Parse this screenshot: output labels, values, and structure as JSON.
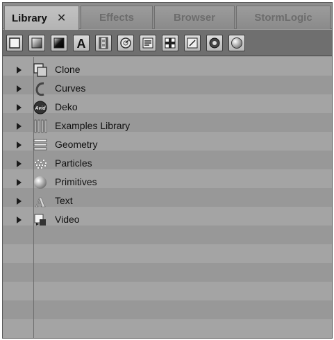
{
  "tabs": [
    {
      "label": "Library",
      "active": true
    },
    {
      "label": "Effects",
      "active": false
    },
    {
      "label": "Browser",
      "active": false
    },
    {
      "label": "StormLogic",
      "active": false
    }
  ],
  "tab_close_symbol": "✕",
  "toolbar_icons": [
    "square-outline-icon",
    "gradient-square-icon",
    "dark-gradient-square-icon",
    "letter-a-icon",
    "film-strip-icon",
    "dial-icon",
    "text-block-icon",
    "plus-grid-icon",
    "diagonal-line-box-icon",
    "donut-icon",
    "sphere-icon"
  ],
  "toolbar_letter": "A",
  "library_items": [
    {
      "label": "Clone",
      "icon": "clone-icon"
    },
    {
      "label": "Curves",
      "icon": "curves-icon"
    },
    {
      "label": "Deko",
      "icon": "deko-icon",
      "icon_text": "Avid"
    },
    {
      "label": "Examples Library",
      "icon": "examples-library-icon"
    },
    {
      "label": "Geometry",
      "icon": "geometry-icon"
    },
    {
      "label": "Particles",
      "icon": "particles-icon"
    },
    {
      "label": "Primitives",
      "icon": "primitives-icon"
    },
    {
      "label": "Text",
      "icon": "text-icon",
      "icon_text": "A"
    },
    {
      "label": "Video",
      "icon": "video-icon"
    }
  ]
}
